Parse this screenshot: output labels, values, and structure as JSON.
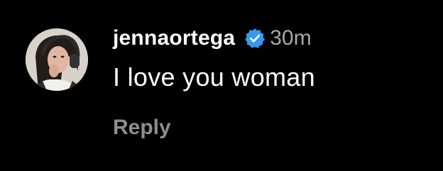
{
  "comment": {
    "avatar_icon": "profile-photo",
    "username": "jennaortega",
    "verified_icon": "verified-badge-icon",
    "verified_color": "#3897f0",
    "timestamp": "30m",
    "text": "I love you woman",
    "reply_label": "Reply"
  }
}
